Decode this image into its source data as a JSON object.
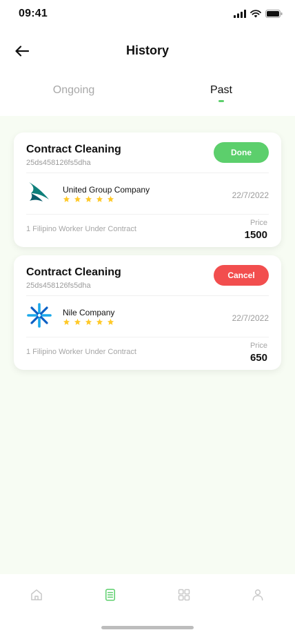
{
  "status_bar": {
    "time": "09:41"
  },
  "header": {
    "title": "History"
  },
  "tabs": [
    {
      "label": "Ongoing",
      "active": false
    },
    {
      "label": "Past",
      "active": true
    }
  ],
  "orders": [
    {
      "title": "Contract Cleaning",
      "code": "25ds458126fs5dha",
      "status": "Done",
      "company": "United Group Company",
      "rating": 5,
      "date": "22/7/2022",
      "workers": "1 Filipino Worker Under Contract",
      "price_label": "Price",
      "price": "1500"
    },
    {
      "title": "Contract Cleaning",
      "code": "25ds458126fs5dha",
      "status": "Cancel",
      "company": "Nile Company",
      "rating": 5,
      "date": "22/7/2022",
      "workers": "1 Filipino Worker Under Contract",
      "price_label": "Price",
      "price": "650"
    }
  ],
  "bottom_nav": [
    {
      "icon": "home-icon",
      "active": false
    },
    {
      "icon": "document-icon",
      "active": true
    },
    {
      "icon": "grid-icon",
      "active": false
    },
    {
      "icon": "profile-icon",
      "active": false
    }
  ],
  "colors": {
    "accent": "#5ccf6c",
    "cancel": "#f24e4e",
    "star": "#ffc928",
    "background_tint": "#f7fcf3"
  }
}
